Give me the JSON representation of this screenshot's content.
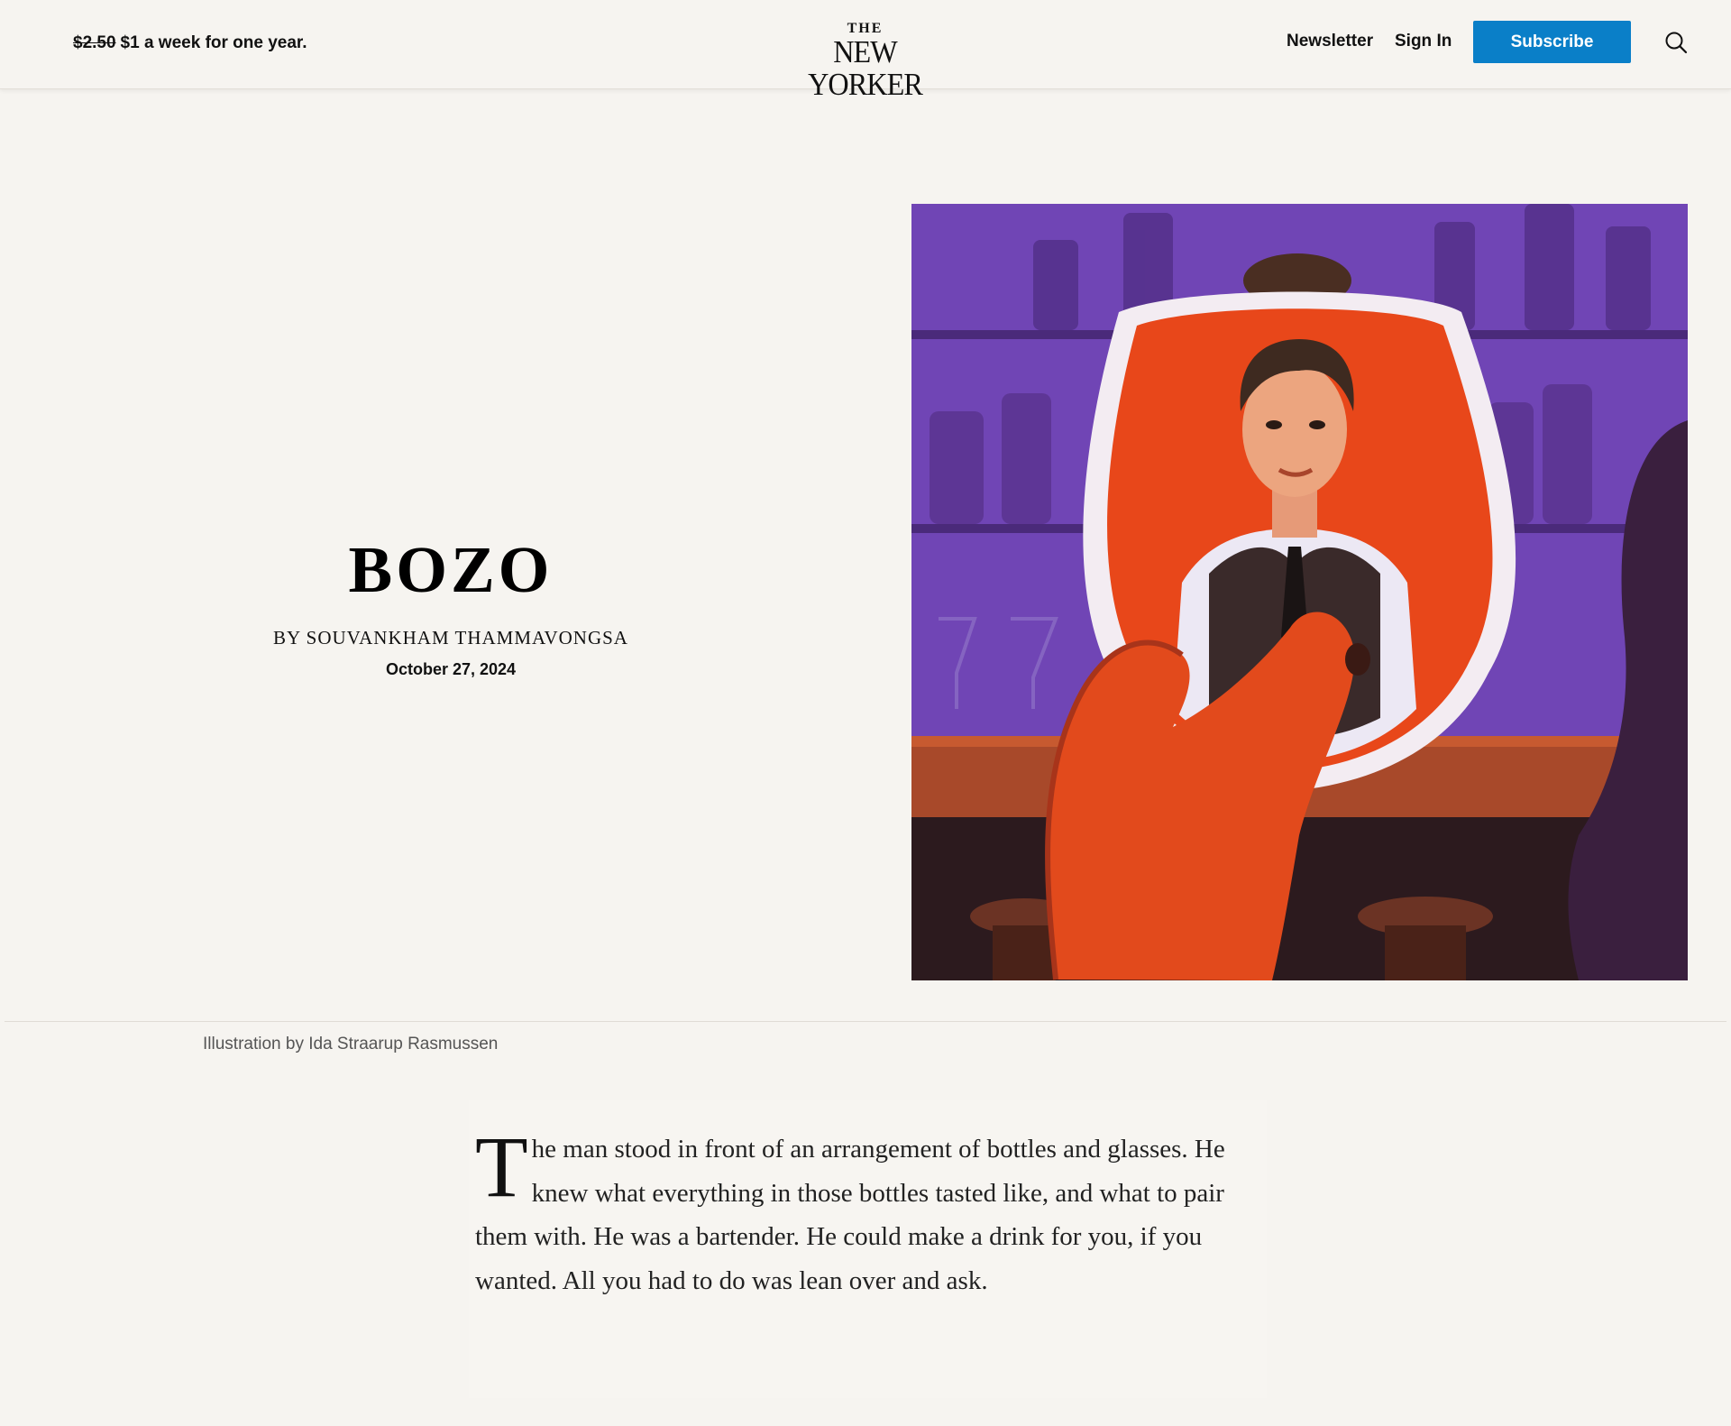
{
  "header": {
    "promo_old_price": "$2.50",
    "promo_text": "$1 a week for one year.",
    "logo_the": "THE",
    "logo_name": "NEW YORKER",
    "nav": {
      "newsletter": "Newsletter",
      "sign_in": "Sign In"
    },
    "subscribe_label": "Subscribe"
  },
  "article": {
    "title": "BOZO",
    "byline": "By Souvankham Thammavongsa",
    "date": "October 27, 2024",
    "illustration_credit": "Illustration by Ida Straarup Rasmussen",
    "body_dropcap": "T",
    "body_text": "he man stood in front of an arrangement of bottles and glasses. He knew what everything in those bottles tasted like, and what to pair them with. He was a bartender. He could make a drink for you, if you wanted. All you had to do was lean over and ask."
  },
  "colors": {
    "background": "#f6f4f0",
    "subscribe_button": "#0a7fc8",
    "illustration_purple": "#6a3fb0",
    "illustration_orange": "#e8471a"
  }
}
